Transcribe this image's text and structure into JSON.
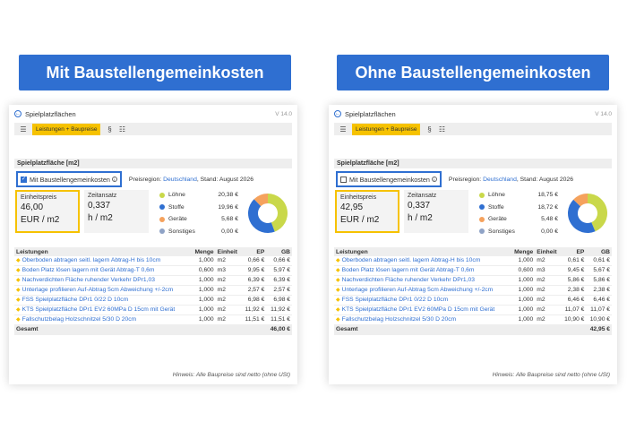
{
  "banners": {
    "left": "Mit Baustellengemeinkosten",
    "right": "Ohne Baustellengemeinkosten"
  },
  "panels": {
    "left": {
      "title": "Spielplatzflächen",
      "version": "V 14.0",
      "tab_label": "Leistungen + Baupreise",
      "section_title": "Spielplatzfläche [m2]",
      "checkbox_label": "Mit Baustellengemeinkosten",
      "checked": true,
      "preisregion_label": "Preisregion:",
      "preisregion_value": "Deutschland",
      "stand": ", Stand: August 2026",
      "einheitspreis_label": "Einheitspreis",
      "einheitspreis_value": "46,00",
      "einheitspreis_unit": "EUR / m2",
      "zeitansatz_label": "Zeitansatz",
      "zeitansatz_value": "0,337",
      "zeitansatz_unit": "h / m2",
      "legend": [
        {
          "label": "Löhne",
          "value": "20,38 €",
          "color": "#c9d84a"
        },
        {
          "label": "Stoffe",
          "value": "19,96 €",
          "color": "#2f6fd1"
        },
        {
          "label": "Geräte",
          "value": "5,68 €",
          "color": "#f5a25d"
        },
        {
          "label": "Sonstiges",
          "value": "0,00 €",
          "color": "#8fa3c6"
        }
      ],
      "table_headers": {
        "leistungen": "Leistungen",
        "menge": "Menge",
        "einheit": "Einheit",
        "ep": "EP",
        "gb": "GB"
      },
      "rows": [
        {
          "name": "Oberboden abtragen seitl. lagern Abtrag-H bis 10cm",
          "menge": "1,000",
          "einheit": "m2",
          "ep": "0,66 €",
          "gb": "0,66 €"
        },
        {
          "name": "Boden Platz lösen lagern mit Gerät Abtrag-T 0,6m",
          "menge": "0,600",
          "einheit": "m3",
          "ep": "9,95 €",
          "gb": "5,97 €"
        },
        {
          "name": "Nachverdichten Fläche ruhender Verkehr DPr1,03",
          "menge": "1,000",
          "einheit": "m2",
          "ep": "6,39 €",
          "gb": "6,39 €"
        },
        {
          "name": "Unterlage profilieren Auf-Abtrag 5cm Abweichung +/-2cm",
          "menge": "1,000",
          "einheit": "m2",
          "ep": "2,57 €",
          "gb": "2,57 €"
        },
        {
          "name": "FSS Spielplatzfläche DPr1 0/22 D 10cm",
          "menge": "1,000",
          "einheit": "m2",
          "ep": "6,98 €",
          "gb": "6,98 €"
        },
        {
          "name": "KTS Spielplatzfläche DPr1 EV2 60MPa D 15cm mit Gerät",
          "menge": "1,000",
          "einheit": "m2",
          "ep": "11,92 €",
          "gb": "11,92 €"
        },
        {
          "name": "Fallschutzbelag Holzschnitzel 5/30 D 20cm",
          "menge": "1,000",
          "einheit": "m2",
          "ep": "11,51 €",
          "gb": "11,51 €"
        }
      ],
      "total_label": "Gesamt",
      "total_value": "46,00 €",
      "hint": "Hinweis: Alle Baupreise sind netto (ohne USt)"
    },
    "right": {
      "title": "Spielplatzflächen",
      "version": "V 14.0",
      "tab_label": "Leistungen + Baupreise",
      "section_title": "Spielplatzfläche [m2]",
      "checkbox_label": "Mit Baustellengemeinkosten",
      "checked": false,
      "preisregion_label": "Preisregion:",
      "preisregion_value": "Deutschland",
      "stand": ", Stand: August 2026",
      "einheitspreis_label": "Einheitspreis",
      "einheitspreis_value": "42,95",
      "einheitspreis_unit": "EUR / m2",
      "zeitansatz_label": "Zeitansatz",
      "zeitansatz_value": "0,337",
      "zeitansatz_unit": "h / m2",
      "legend": [
        {
          "label": "Löhne",
          "value": "18,75 €",
          "color": "#c9d84a"
        },
        {
          "label": "Stoffe",
          "value": "18,72 €",
          "color": "#2f6fd1"
        },
        {
          "label": "Geräte",
          "value": "5,48 €",
          "color": "#f5a25d"
        },
        {
          "label": "Sonstiges",
          "value": "0,00 €",
          "color": "#8fa3c6"
        }
      ],
      "table_headers": {
        "leistungen": "Leistungen",
        "menge": "Menge",
        "einheit": "Einheit",
        "ep": "EP",
        "gb": "GB"
      },
      "rows": [
        {
          "name": "Oberboden abtragen seitl. lagern Abtrag-H bis 10cm",
          "menge": "1,000",
          "einheit": "m2",
          "ep": "0,61 €",
          "gb": "0,61 €"
        },
        {
          "name": "Boden Platz lösen lagern mit Gerät Abtrag-T 0,6m",
          "menge": "0,600",
          "einheit": "m3",
          "ep": "9,45 €",
          "gb": "5,67 €"
        },
        {
          "name": "Nachverdichten Fläche ruhender Verkehr DPr1,03",
          "menge": "1,000",
          "einheit": "m2",
          "ep": "5,86 €",
          "gb": "5,86 €"
        },
        {
          "name": "Unterlage profilieren Auf-Abtrag 5cm Abweichung +/-2cm",
          "menge": "1,000",
          "einheit": "m2",
          "ep": "2,38 €",
          "gb": "2,38 €"
        },
        {
          "name": "FSS Spielplatzfläche DPr1 0/22 D 10cm",
          "menge": "1,000",
          "einheit": "m2",
          "ep": "6,46 €",
          "gb": "6,46 €"
        },
        {
          "name": "KTS Spielplatzfläche DPr1 EV2 60MPa D 15cm mit Gerät",
          "menge": "1,000",
          "einheit": "m2",
          "ep": "11,07 €",
          "gb": "11,07 €"
        },
        {
          "name": "Fallschutzbelag Holzschnitzel 5/30 D 20cm",
          "menge": "1,000",
          "einheit": "m2",
          "ep": "10,90 €",
          "gb": "10,90 €"
        }
      ],
      "total_label": "Gesamt",
      "total_value": "42,95 €",
      "hint": "Hinweis: Alle Baupreise sind netto (ohne USt)"
    }
  }
}
